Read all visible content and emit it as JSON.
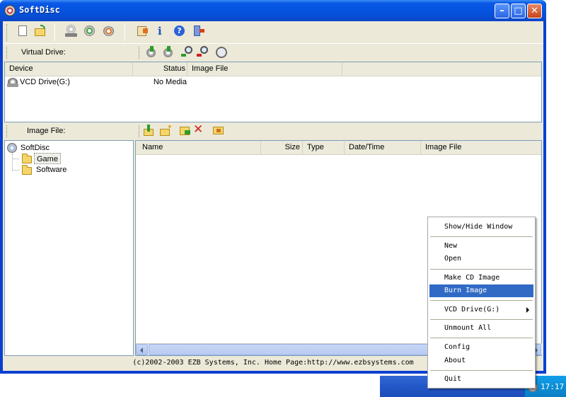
{
  "window": {
    "title": "SoftDisc"
  },
  "virtual_drive_toolbar": {
    "label": "Virtual Drive:"
  },
  "device_list": {
    "columns": [
      "Device",
      "Status",
      "Image File"
    ],
    "rows": [
      {
        "device": "VCD Drive(G:)",
        "status": "No Media",
        "image_file": ""
      }
    ]
  },
  "image_toolbar": {
    "label": "Image File:"
  },
  "tree": {
    "root": "SoftDisc",
    "children": [
      "Game",
      "Software"
    ]
  },
  "file_list": {
    "columns": [
      "Name",
      "Size",
      "Type",
      "Date/Time",
      "Image File"
    ]
  },
  "status_bar": {
    "text": "(c)2002-2003 EZB Systems, Inc. Home Page:http://www.ezbsystems.com"
  },
  "context_menu": {
    "items": [
      "Show/Hide Window",
      "New",
      "Open",
      "Make CD Image",
      "Burn Image",
      "VCD Drive(G:)",
      "Unmount All",
      "Config",
      "About",
      "Quit"
    ],
    "selected": "Burn Image"
  },
  "taskbar": {
    "clock": "17:17"
  },
  "colors": {
    "title_bar": "#0552dc",
    "menu_highlight": "#316ac5",
    "window_face": "#ece9d8"
  }
}
